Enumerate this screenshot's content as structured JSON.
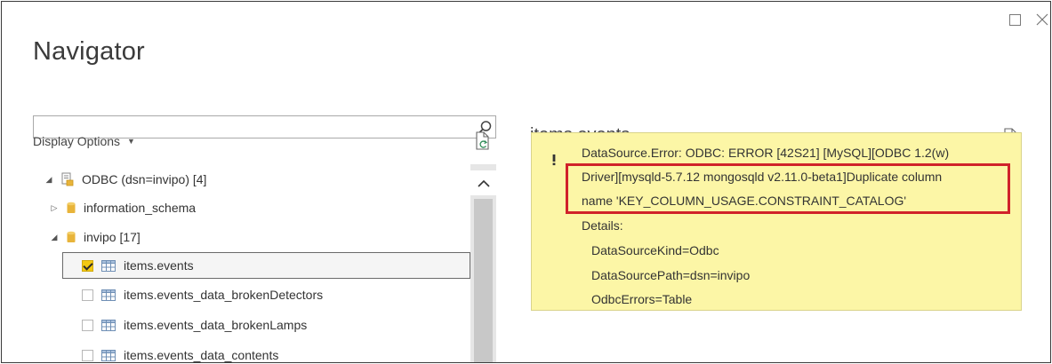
{
  "window": {
    "title": "Navigator"
  },
  "search": {
    "value": "",
    "placeholder": ""
  },
  "display_options": {
    "label": "Display Options"
  },
  "tree": {
    "root": {
      "label": "ODBC (dsn=invipo) [4]"
    },
    "items": [
      {
        "label": "information_schema"
      },
      {
        "label": "invipo [17]"
      }
    ],
    "tables": [
      {
        "label": "items.events",
        "checked": true
      },
      {
        "label": "items.events_data_brokenDetectors",
        "checked": false
      },
      {
        "label": "items.events_data_brokenLamps",
        "checked": false
      },
      {
        "label": "items.events_data_contents",
        "checked": false
      }
    ]
  },
  "preview": {
    "title": "items.events",
    "error": {
      "line1": "DataSource.Error: ODBC: ERROR [42S21] [MySQL][ODBC 1.2(w)",
      "line2": "Driver][mysqld-5.7.12 mongosqld v2.11.0-beta1]Duplicate column",
      "line3": "name 'KEY_COLUMN_USAGE.CONSTRAINT_CATALOG'",
      "details_label": "Details:",
      "details": [
        "DataSourceKind=Odbc",
        "DataSourcePath=dsn=invipo",
        "OdbcErrors=Table"
      ]
    }
  },
  "colors": {
    "error_bg": "#fcf6a6",
    "highlight": "#d0222a",
    "checkbox_checked": "#f2c811"
  }
}
